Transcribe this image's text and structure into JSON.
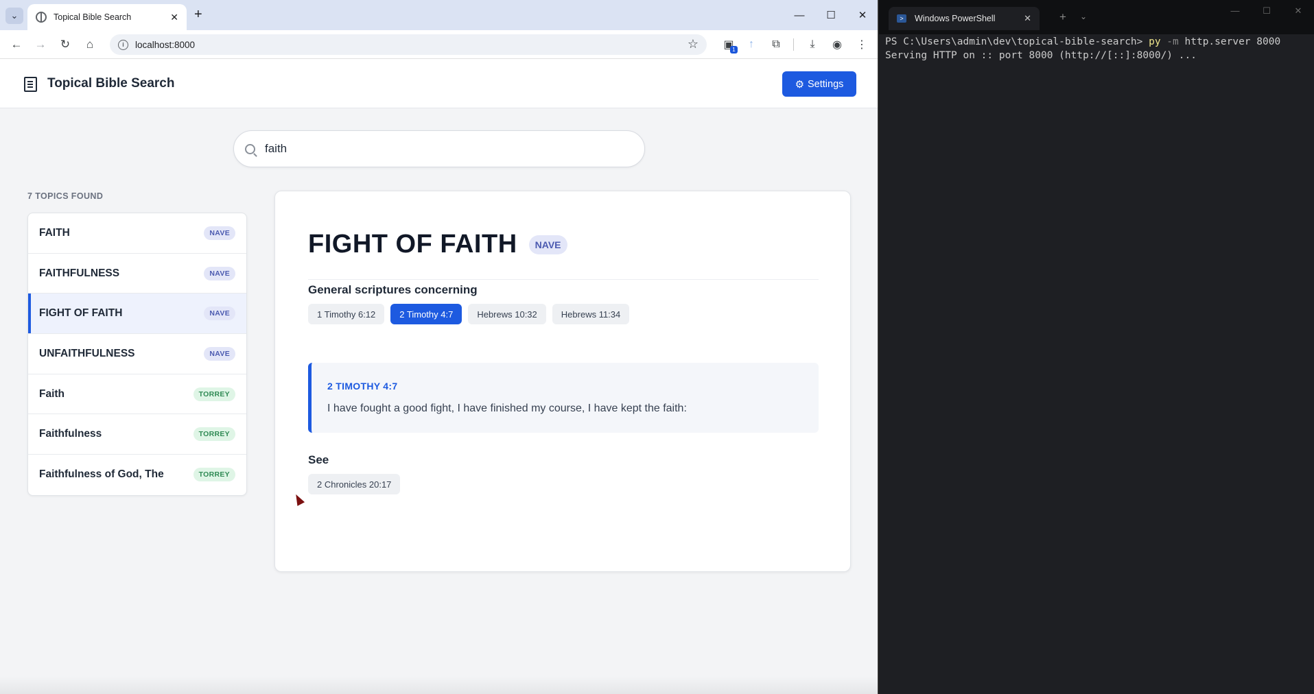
{
  "browser": {
    "tab_title": "Topical Bible Search",
    "url": "localhost:8000",
    "extension_badge": "1",
    "window_controls": [
      "—",
      "☐",
      "✕"
    ]
  },
  "app": {
    "title": "Topical Bible Search",
    "settings_label": "Settings",
    "search": {
      "value": "faith",
      "placeholder": ""
    },
    "results_count": "7 TOPICS FOUND",
    "topics": [
      {
        "name": "FAITH",
        "source": "NAVE",
        "active": false
      },
      {
        "name": "FAITHFULNESS",
        "source": "NAVE",
        "active": false
      },
      {
        "name": "FIGHT OF FAITH",
        "source": "NAVE",
        "active": true
      },
      {
        "name": "UNFAITHFULNESS",
        "source": "NAVE",
        "active": false
      },
      {
        "name": "Faith",
        "source": "TORREY",
        "active": false
      },
      {
        "name": "Faithfulness",
        "source": "TORREY",
        "active": false
      },
      {
        "name": "Faithfulness of God, The",
        "source": "TORREY",
        "active": false
      }
    ],
    "detail": {
      "title": "FIGHT OF FAITH",
      "source": "NAVE",
      "sections": [
        {
          "heading": "General scriptures concerning",
          "refs": [
            "1 Timothy 6:12",
            "2 Timothy 4:7",
            "Hebrews 10:32",
            "Hebrews 11:34"
          ],
          "active_ref": "2 Timothy 4:7"
        },
        {
          "heading": "See",
          "refs": [
            "2 Chronicles 20:17"
          ]
        }
      ],
      "verse": {
        "reference": "2 TIMOTHY 4:7",
        "text": "I have fought a good fight, I have finished my course, I have kept the faith:"
      }
    }
  },
  "terminal": {
    "tab_title": "Windows PowerShell",
    "prompt": "PS C:\\Users\\admin\\dev\\topical-bible-search> ",
    "command": "py",
    "flag": " -m",
    "args": " http.server 8000",
    "output": "Serving HTTP on :: port 8000 (http://[::]:8000/) ..."
  },
  "colors": {
    "accent": "#1d5ae0",
    "nave_badge": "#e3e6f8",
    "torrey_badge": "#dff5e6"
  }
}
